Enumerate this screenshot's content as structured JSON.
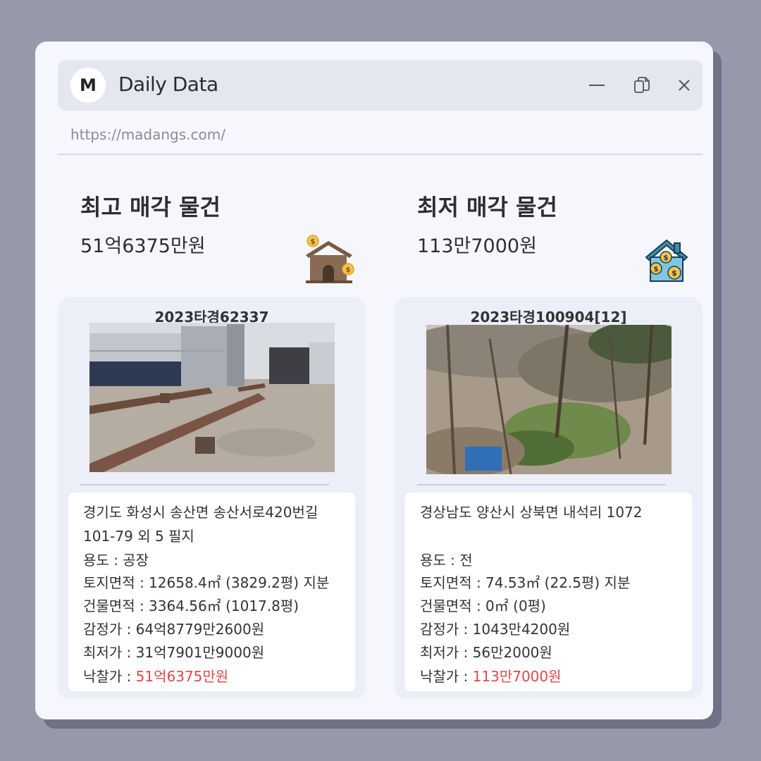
{
  "window": {
    "logo_letter": "M",
    "title": "Daily Data",
    "url": "https://madangs.com/",
    "controls": [
      "minimize",
      "copy",
      "close"
    ]
  },
  "highest": {
    "heading": "최고 매각 물건",
    "price": "51억6375만원",
    "icon": "house-with-coins-icon",
    "case_no": "2023타경62337",
    "address_line1": "경기도 화성시 송산면 송산서로420번길",
    "address_line2": "101-79 외 5 필지",
    "usage": "용도 : 공장",
    "land_area": "토지면적 : 12658.4㎡ (3829.2평) 지분",
    "building_area": "건물면적 : 3364.56㎡ (1017.8평)",
    "appraisal": "감정가 : 64억8779만2600원",
    "minimum": "최저가 : 31억7901만9000원",
    "winning_label": "낙찰가 : ",
    "winning_value": "51억6375만원"
  },
  "lowest": {
    "heading": "최저 매각 물건",
    "price": "113만7000원",
    "icon": "house-with-dollar-coins-icon",
    "case_no": "2023타경100904[12]",
    "address_line1": "경상남도 양산시 상북면 내석리 1072",
    "address_line2": "",
    "usage": "용도 : 전",
    "land_area": "토지면적 : 74.53㎡ (22.5평) 지분",
    "building_area": "건물면적 : 0㎡ (0평)",
    "appraisal": "감정가 : 1043만4200원",
    "minimum": "최저가 : 56만2000원",
    "winning_label": "낙찰가 : ",
    "winning_value": "113만7000원"
  },
  "colors": {
    "background": "#9799ab",
    "window": "#f6f7fc",
    "titlebar": "#e5e7f0",
    "card": "#eceef8",
    "highlight": "#e0484a"
  }
}
